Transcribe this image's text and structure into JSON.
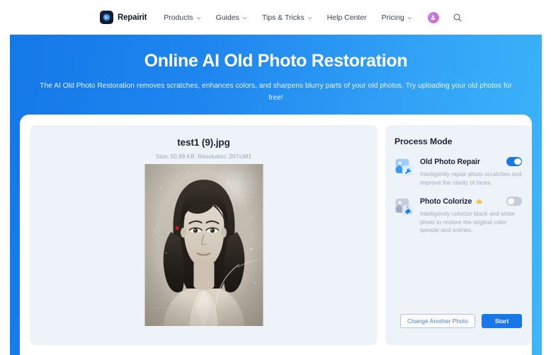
{
  "nav": {
    "brand": "Repairit",
    "brand_logo_icon": "repairit-logo-icon",
    "items": [
      {
        "label": "Products",
        "has_caret": true
      },
      {
        "label": "Guides",
        "has_caret": true
      },
      {
        "label": "Tips & Tricks",
        "has_caret": true
      },
      {
        "label": "Help Center",
        "has_caret": false
      },
      {
        "label": "Pricing",
        "has_caret": true
      }
    ],
    "avatar_icon": "user-avatar-icon",
    "search_icon": "search-icon"
  },
  "hero": {
    "title": "Online AI Old Photo Restoration",
    "subtitle": "The AI Old Photo Restoration removes scratches, enhances colors, and sharpens blurry parts of your old photos. Try uploading your old photos for free!",
    "gradient_from": "#1479e8",
    "gradient_to": "#3db6fa"
  },
  "preview": {
    "file_name": "test1 (9).jpg",
    "file_meta": "Size: 50.89 KB. Resolution: 287x381",
    "photo_alt": "old-photo-portrait",
    "cursor_icon": "red-cursor-dot"
  },
  "process_mode": {
    "title": "Process Mode",
    "modes": [
      {
        "label": "Old Photo Repair",
        "description": "Intelligently repair photo scratches and improve the clarity of faces.",
        "icon": "photo-wrench-icon",
        "enabled": true,
        "premium": false
      },
      {
        "label": "Photo Colorize",
        "description": "Intelligendy colorize black and white photo to restore the original color ipeople and scenes.",
        "icon": "photo-paint-bucket-icon",
        "enabled": false,
        "premium": true,
        "premium_badge_icon": "crown-icon"
      }
    ],
    "toggle_on_color": "#1878e8",
    "toggle_off_color": "#c6ccd8"
  },
  "actions": {
    "change_photo_label": "Change Another Photo",
    "start_label": "Start",
    "primary_color": "#1878e8"
  }
}
